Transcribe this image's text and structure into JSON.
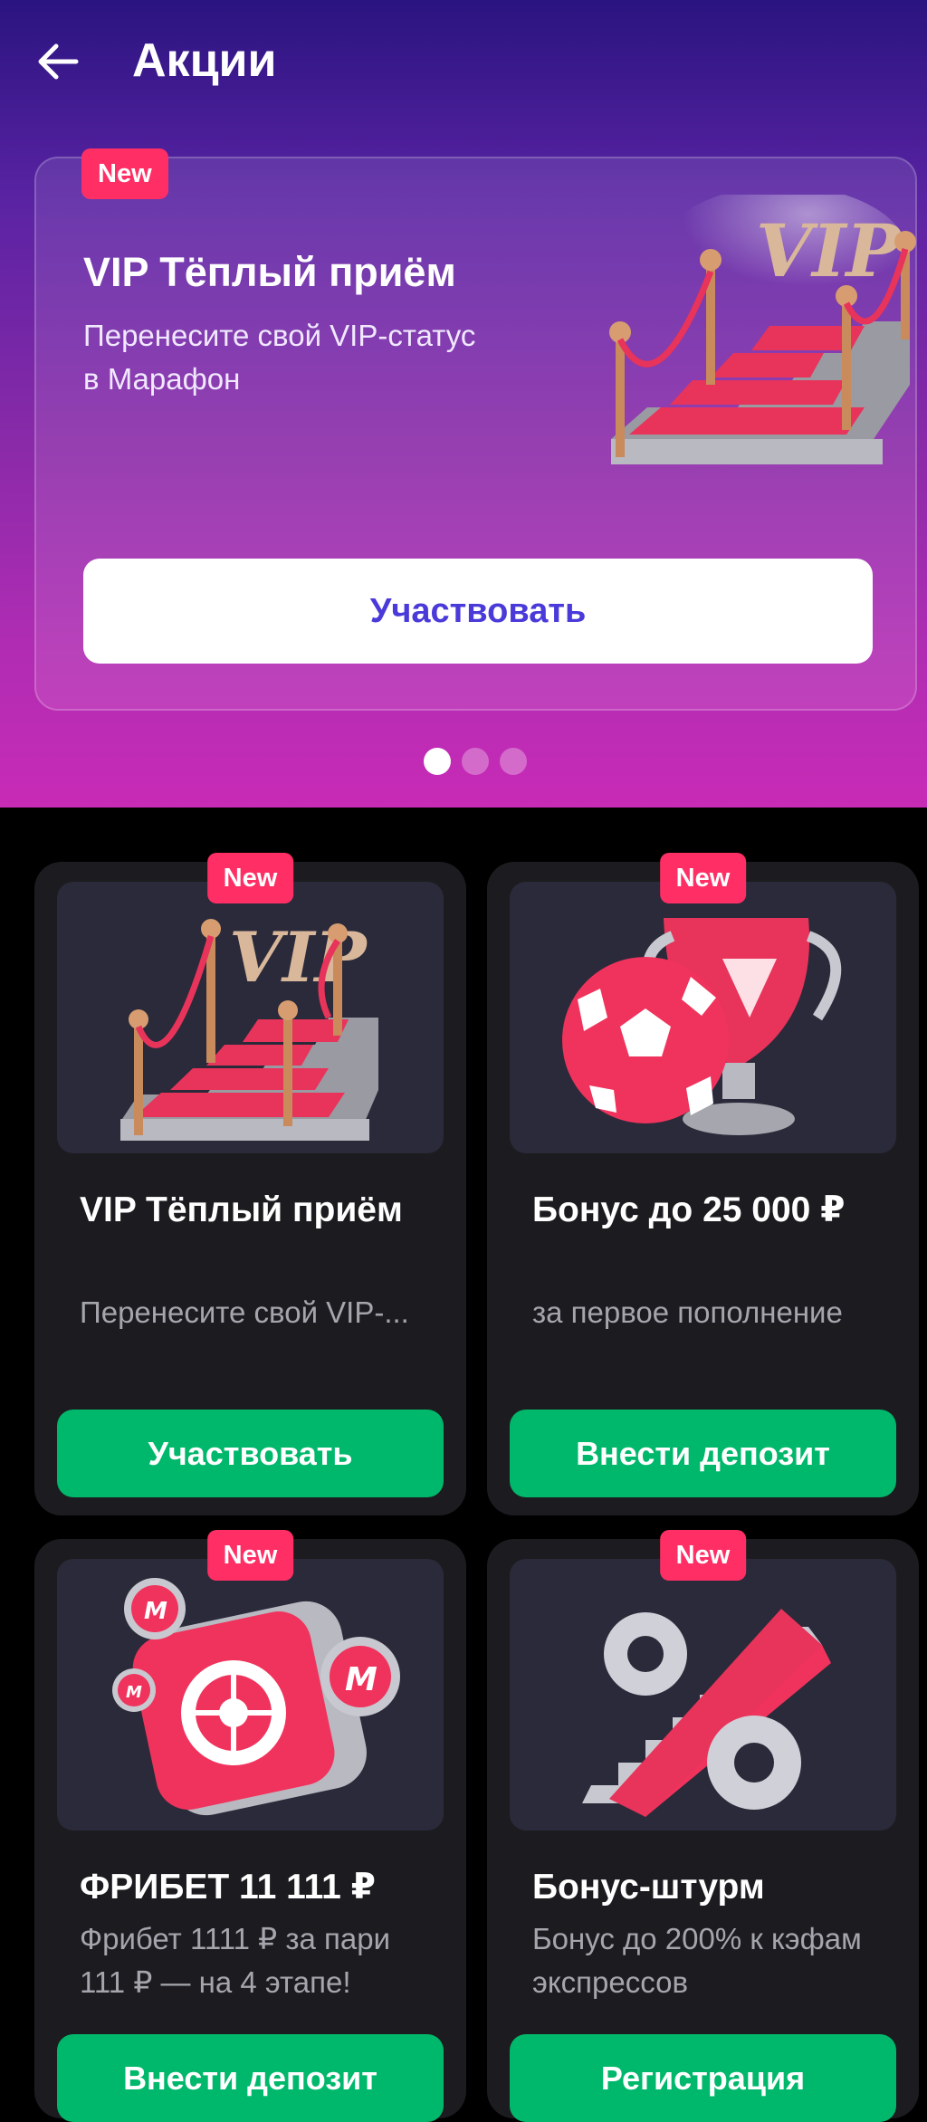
{
  "header": {
    "title": "Акции",
    "back_icon": "arrow-left-icon"
  },
  "hero": {
    "badge": "New",
    "title": "VIP Тёплый приём",
    "subtitle": "Перенесите свой VIP-статус в Марафон",
    "cta": "Участвовать",
    "image_icon": "vip-stairs-icon",
    "dots_count": 3,
    "active_dot": 1
  },
  "colors": {
    "accent_red": "#ff2f66",
    "cta_green": "#00b86b",
    "hero_cta_text": "#4a3ad9",
    "card_bg": "#1c1c20"
  },
  "promos": [
    {
      "badge": "New",
      "title": "VIP Тёплый приём",
      "subtitle": "Перенесите свой VIP-...",
      "cta": "Участвовать",
      "image_icon": "vip-stairs-icon"
    },
    {
      "badge": "New",
      "title": "Бонус до 25 000 ₽",
      "subtitle": "за первое пополнение",
      "cta": "Внести депозит",
      "image_icon": "soccer-ball-trophy-icon"
    },
    {
      "badge": "New",
      "title": "ФРИБЕТ 11 111 ₽",
      "subtitle": "Фрибет 1111 ₽ за пари 111 ₽ — на 4 этапе!",
      "cta": "Внести депозит",
      "image_icon": "safe-coins-icon"
    },
    {
      "badge": "New",
      "title": "Бонус-штурм",
      "subtitle": "Бонус до 200% к кэфам экспрессов",
      "cta": "Регистрация",
      "image_icon": "percent-stairs-icon"
    }
  ]
}
